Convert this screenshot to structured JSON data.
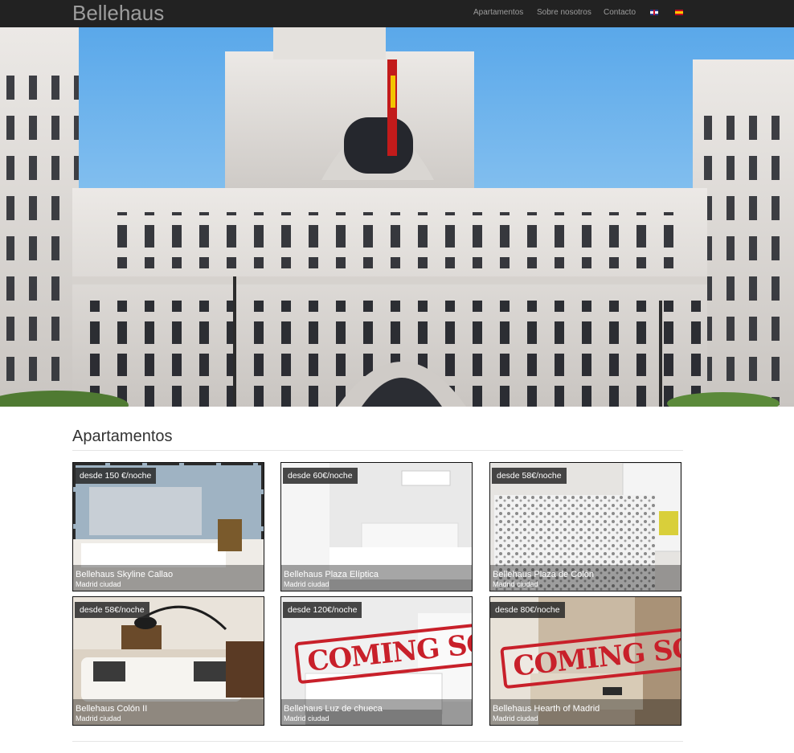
{
  "brand": "Bellehaus",
  "nav": {
    "items": [
      "Apartamentos",
      "Sobre nosotros",
      "Contacto"
    ],
    "languages": [
      {
        "code": "en",
        "icon": "uk-flag-icon"
      },
      {
        "code": "es",
        "icon": "spain-flag-icon"
      }
    ]
  },
  "section": {
    "title": "Apartamentos"
  },
  "apartments": [
    {
      "price": "desde 150 €/noche",
      "name": "Bellehaus Skyline Callao",
      "location": "Madrid ciudad"
    },
    {
      "price": "desde 60€/noche",
      "name": "Bellehaus Plaza Elíptica",
      "location": "Madrid ciudad"
    },
    {
      "price": "desde 58€/noche",
      "name": "Bellehaus Plaza de Colón",
      "location": "Madrid ciudad"
    },
    {
      "price": "desde 58€/noche",
      "name": "Bellehaus Colón II",
      "location": "Madrid ciudad"
    },
    {
      "price": "desde 120€/noche",
      "name": "Bellehaus Luz de chueca",
      "location": "Madrid ciudad",
      "stamp": "COMING SOON"
    },
    {
      "price": "desde 80€/noche",
      "name": "Bellehaus Hearth of Madrid",
      "location": "Madrid ciudad",
      "stamp": "COMING SOON"
    }
  ],
  "colors": {
    "navbar": "#222222",
    "nav_text": "#9d9d9d",
    "stamp": "#c8202a",
    "sky": "#8fc6ef"
  }
}
